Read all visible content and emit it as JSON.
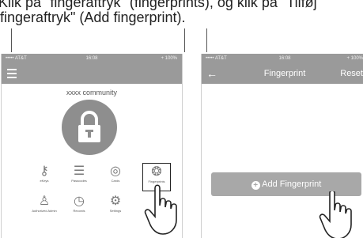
{
  "caption": {
    "line1": "Klik på \"fingeraftryk\" (fingerprints), og klik på \"Tilføj",
    "line2": "fingeraftryk\" (Add fingerprint)."
  },
  "left_screen": {
    "status": {
      "carrier": "••••• AT&T",
      "time": "16:08",
      "battery": "+ 100%"
    },
    "community_title": "xxxx community",
    "grid": [
      {
        "label": "eKeys",
        "icon": "key-icon"
      },
      {
        "label": "Passcodes",
        "icon": "list-icon"
      },
      {
        "label": "Cards",
        "icon": "card-icon"
      },
      {
        "label": "Fingerprints",
        "icon": "fingerprint-icon"
      },
      {
        "label": "Authorized Admin",
        "icon": "admin-icon"
      },
      {
        "label": "Records",
        "icon": "clock-icon"
      },
      {
        "label": "Settings",
        "icon": "gear-icon"
      }
    ]
  },
  "right_screen": {
    "status": {
      "carrier": "••••• AT&T",
      "time": "16:08",
      "battery": "+ 100%"
    },
    "nav_title": "Fingerprint",
    "nav_right": "Reset",
    "button_label": "Add Fingerprint"
  }
}
